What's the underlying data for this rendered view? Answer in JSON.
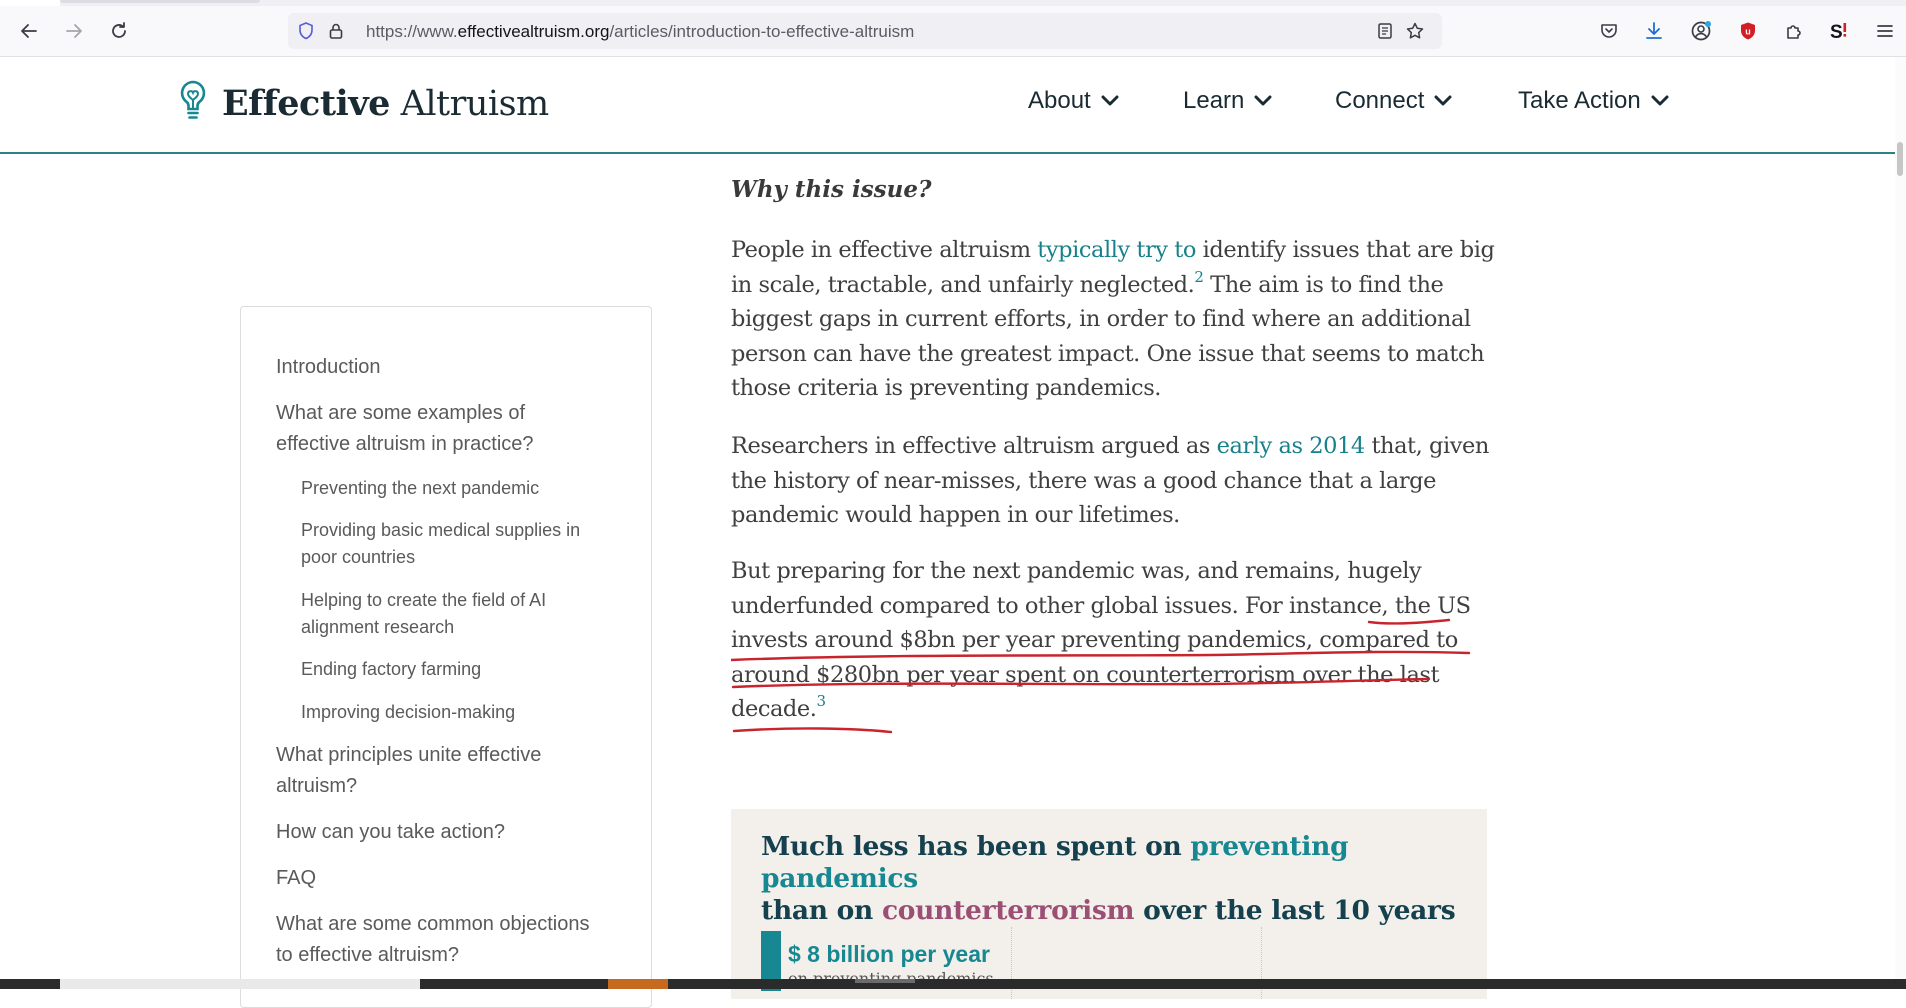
{
  "browser": {
    "url_prefix": "https://www.",
    "url_host": "effectivealtruism.org",
    "url_path": "/articles/introduction-to-effective-altruism"
  },
  "site": {
    "logo_bold": "Effective",
    "logo_light": " Altruism",
    "nav": [
      {
        "label": "About"
      },
      {
        "label": "Learn"
      },
      {
        "label": "Connect"
      },
      {
        "label": "Take Action"
      }
    ]
  },
  "toc": {
    "items": [
      {
        "label": "Introduction"
      },
      {
        "label_lines": [
          "What are some examples of",
          "effective altruism in practice?"
        ]
      },
      {
        "label": "Preventing the next pandemic"
      },
      {
        "label_lines": [
          "Providing basic medical supplies in",
          "poor countries"
        ]
      },
      {
        "label_lines": [
          "Helping to create the field of AI",
          "alignment research"
        ]
      },
      {
        "label": "Ending factory farming"
      },
      {
        "label": "Improving decision-making"
      },
      {
        "label_lines": [
          "What principles unite effective",
          "altruism?"
        ]
      },
      {
        "label": "How can you take action?"
      },
      {
        "label": "FAQ"
      },
      {
        "label_lines": [
          "What are some common objections",
          "to effective altruism?"
        ]
      }
    ]
  },
  "article": {
    "section_question": "Why this issue?",
    "p1": {
      "l1_a": "People in effective altruism ",
      "l1_link": "typically try to",
      "l1_b": " identify issues that are big",
      "l2_a": "in scale, tractable, and unfairly neglected.",
      "l2_sup": "2",
      "l2_b": " The aim is to find the",
      "l3": "biggest gaps in current efforts, in order to find where an additional",
      "l4": "person can have the greatest impact. One issue that seems to match",
      "l5": "those criteria is preventing pandemics."
    },
    "p2": {
      "l1_a": "Researchers in effective altruism argued as ",
      "l1_link": "early as 2014",
      "l1_b": " that, given",
      "l2": "the history of near-misses, there was a good chance that a large",
      "l3": "pandemic would happen in our lifetimes."
    },
    "p3": {
      "l1": "But preparing for the next pandemic was, and remains, hugely",
      "l2": "underfunded compared to other global issues. For instance, the US",
      "l3": "invests around $8bn per year preventing pandemics, compared to",
      "l4": "around $280bn per year spent on counterterrorism over the last",
      "l5": "decade.",
      "l5_sup": "3"
    }
  },
  "chart_card": {
    "title_a": "Much less has been spent on ",
    "title_teal": "preventing pandemics",
    "title_b": "than on ",
    "title_plum": "counterterrorism",
    "title_c": " over the last 10 years",
    "bar_label": "$ 8 billion per year",
    "bar_sub": "on preventing pandemics",
    "colors": {
      "teal": "#178891",
      "plum": "#9b4f74",
      "navy": "#15414e"
    }
  }
}
